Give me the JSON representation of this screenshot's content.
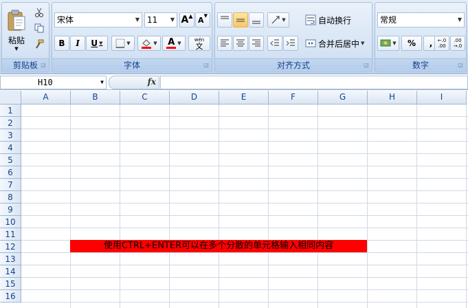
{
  "ribbon": {
    "clipboard": {
      "paste_label": "粘贴",
      "group_label": "剪贴板"
    },
    "font": {
      "font_name": "宋体",
      "font_size": "11",
      "group_label": "字体",
      "grow_label": "A",
      "shrink_label": "A",
      "bold": "B",
      "italic": "I",
      "underline": "U",
      "font_color_label": "A",
      "phonetic_top": "wén",
      "phonetic_bottom": "文"
    },
    "alignment": {
      "wrap_text_label": "自动换行",
      "merge_center_label": "合并后居中",
      "group_label": "对齐方式"
    },
    "number": {
      "format_value": "常规",
      "percent": "%",
      "comma": ",",
      "inc_decimal": "←.0\n.00",
      "dec_decimal": ".00\n→.0",
      "group_label": "数字"
    }
  },
  "formula_bar": {
    "name_box": "H10",
    "fx": "fx",
    "formula": ""
  },
  "sheet": {
    "columns": [
      "A",
      "B",
      "C",
      "D",
      "E",
      "F",
      "G",
      "H",
      "I"
    ],
    "rows": [
      "1",
      "2",
      "3",
      "4",
      "5",
      "6",
      "7",
      "8",
      "9",
      "10",
      "11",
      "12",
      "13",
      "14",
      "15",
      "16"
    ],
    "highlight_text": "使用CTRL+ENTER可以在多个分散的单元格输入相同内容",
    "highlight_color": "#ff0000"
  }
}
